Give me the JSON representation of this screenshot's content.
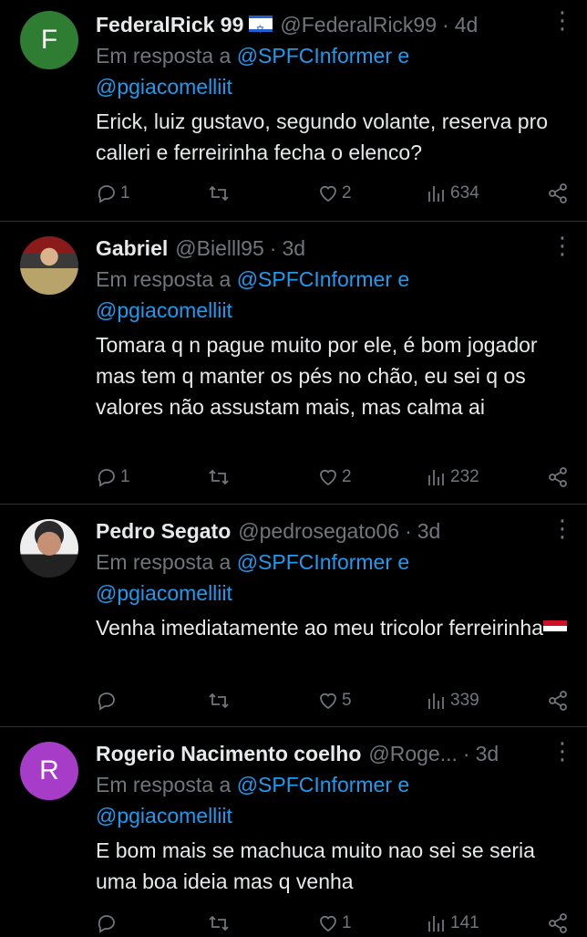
{
  "tweets": [
    {
      "avatar_letter": "F",
      "author": "FederalRick 99",
      "handle": "@FederalRick99",
      "time": "4d",
      "reply_prefix": "Em resposta a",
      "mention1": "@SPFCInformer",
      "conj": "e",
      "mention2": "@pgiacomelliit",
      "text": "Erick, luiz gustavo, segundo volante, reserva pro calleri e ferreirinha fecha o elenco?",
      "replies": "1",
      "retweets": "",
      "likes": "2",
      "views": "634"
    },
    {
      "avatar_letter": "",
      "author": "Gabriel",
      "handle": "@Bielll95",
      "time": "3d",
      "reply_prefix": "Em resposta a",
      "mention1": "@SPFCInformer",
      "conj": "e",
      "mention2": "@pgiacomelliit",
      "text": "Tomara q n pague muito por ele, é bom jogador mas tem q manter os pés no chão, eu sei q os valores não assustam mais, mas calma ai",
      "replies": "1",
      "retweets": "",
      "likes": "2",
      "views": "232"
    },
    {
      "avatar_letter": "",
      "author": "Pedro Segato",
      "handle": "@pedrosegato06",
      "time": "3d",
      "reply_prefix": "Em resposta a",
      "mention1": "@SPFCInformer",
      "conj": "e",
      "mention2": "@pgiacomelliit",
      "text": "Venha imediatamente ao meu tricolor ferreirinha",
      "replies": "",
      "retweets": "",
      "likes": "5",
      "views": "339"
    },
    {
      "avatar_letter": "R",
      "author": "Rogerio Nacimento coelho",
      "handle": "@Roge...",
      "time": "3d",
      "reply_prefix": "Em resposta a",
      "mention1": "@SPFCInformer",
      "conj": "e",
      "mention2": "@pgiacomelliit",
      "text": "E bom mais se machuca muito nao sei se seria uma boa ideia mas q venha",
      "replies": "",
      "retweets": "",
      "likes": "1",
      "views": "141"
    }
  ],
  "icons": {
    "reply": "reply-icon",
    "retweet": "retweet-icon",
    "like": "heart-icon",
    "views": "views-icon",
    "share": "share-icon",
    "more": "more-icon"
  },
  "colors": {
    "background": "#000000",
    "text": "#e7e9ea",
    "muted": "#71767b",
    "link": "#1d9bf0",
    "divider": "#2f3336"
  },
  "separator": "·"
}
